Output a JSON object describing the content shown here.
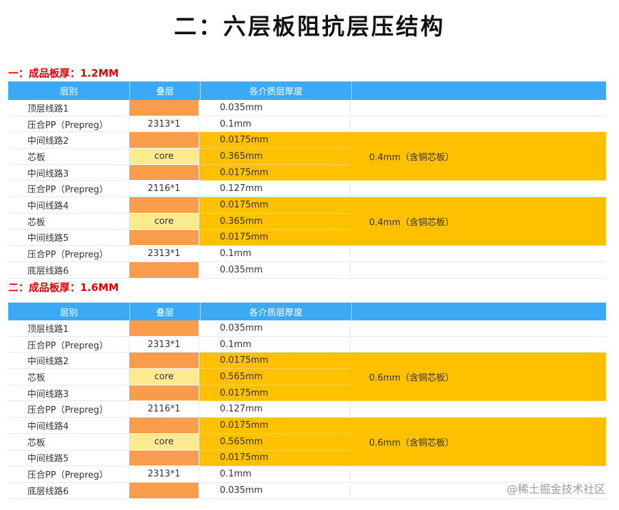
{
  "main_title": "二：六层板阻抗层压结构",
  "header": {
    "col1": "层别",
    "col2": "叠层",
    "col3": "各介质层厚度"
  },
  "section1": {
    "title": "一：成品板厚：1.2MM",
    "rows": [
      {
        "layer": "顶层线路1",
        "stack": "",
        "thickness": "0.035mm",
        "fill": "#f99d4d",
        "highlight": false
      },
      {
        "layer": "压合PP（Prepreg）",
        "stack": "2313*1",
        "thickness": "0.1mm",
        "fill": "",
        "highlight": false
      },
      {
        "layer": "中间线路2",
        "stack": "",
        "thickness": "0.0175mm",
        "fill": "#f99d4d",
        "highlight": true
      },
      {
        "layer": "芯板",
        "stack": "core",
        "thickness": "0.365mm",
        "fill": "#fcea8e",
        "highlight": true
      },
      {
        "layer": "中间线路3",
        "stack": "",
        "thickness": "0.0175mm",
        "fill": "#f99d4d",
        "highlight": true
      },
      {
        "layer": "压合PP（Prepreg）",
        "stack": "2116*1",
        "thickness": "0.127mm",
        "fill": "",
        "highlight": false
      },
      {
        "layer": "中间线路4",
        "stack": "",
        "thickness": "0.0175mm",
        "fill": "#f99d4d",
        "highlight": true
      },
      {
        "layer": "芯板",
        "stack": "core",
        "thickness": "0.365mm",
        "fill": "#fcea8e",
        "highlight": true
      },
      {
        "layer": "中间线路5",
        "stack": "",
        "thickness": "0.0175mm",
        "fill": "#f99d4d",
        "highlight": true
      },
      {
        "layer": "压合PP（Prepreg）",
        "stack": "2313*1",
        "thickness": "0.1mm",
        "fill": "",
        "highlight": false
      },
      {
        "layer": "底层线路6",
        "stack": "",
        "thickness": "0.035mm",
        "fill": "#f99d4d",
        "highlight": false
      }
    ],
    "core_notes": [
      "0.4mm（含铜芯板）",
      "0.4mm（含铜芯板）"
    ]
  },
  "section2": {
    "title": "二：成品板厚：1.6MM",
    "rows": [
      {
        "layer": "顶层线路1",
        "stack": "",
        "thickness": "0.035mm",
        "fill": "#f99d4d",
        "highlight": false
      },
      {
        "layer": "压合PP（Prepreg）",
        "stack": "2313*1",
        "thickness": "0.1mm",
        "fill": "",
        "highlight": false
      },
      {
        "layer": "中间线路2",
        "stack": "",
        "thickness": "0.0175mm",
        "fill": "#f99d4d",
        "highlight": true
      },
      {
        "layer": "芯板",
        "stack": "core",
        "thickness": "0.565mm",
        "fill": "#fcea8e",
        "highlight": true
      },
      {
        "layer": "中间线路3",
        "stack": "",
        "thickness": "0.0175mm",
        "fill": "#f99d4d",
        "highlight": true
      },
      {
        "layer": "压合PP（Prepreg）",
        "stack": "2116*1",
        "thickness": "0.127mm",
        "fill": "",
        "highlight": false
      },
      {
        "layer": "中间线路4",
        "stack": "",
        "thickness": "0.0175mm",
        "fill": "#f99d4d",
        "highlight": true
      },
      {
        "layer": "芯板",
        "stack": "core",
        "thickness": "0.565mm",
        "fill": "#fcea8e",
        "highlight": true
      },
      {
        "layer": "中间线路5",
        "stack": "",
        "thickness": "0.0175mm",
        "fill": "#f99d4d",
        "highlight": true
      },
      {
        "layer": "压合PP（Prepreg）",
        "stack": "2313*1",
        "thickness": "0.1mm",
        "fill": "",
        "highlight": false
      },
      {
        "layer": "底层线路6",
        "stack": "",
        "thickness": "0.035mm",
        "fill": "#f99d4d",
        "highlight": false
      }
    ],
    "core_notes": [
      "0.6mm（含铜芯板）",
      "0.6mm（含铜芯板）"
    ]
  },
  "colors": {
    "header_blue": "#3ca9f5",
    "highlight": "#ffc000",
    "copper": "#f99d4d",
    "core": "#fcea8e",
    "title_red": "#e10000"
  },
  "watermark": "@稀土掘金技术社区"
}
